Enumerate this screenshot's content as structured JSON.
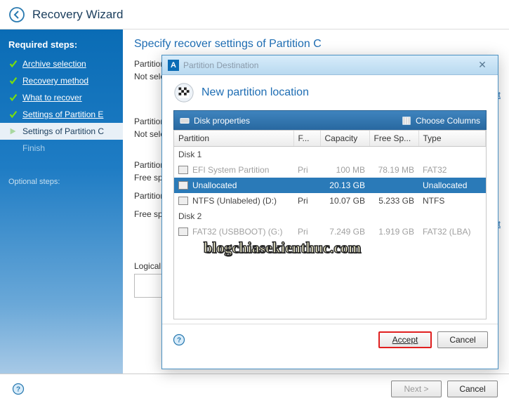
{
  "titlebar": {
    "title": "Recovery Wizard"
  },
  "sidebar": {
    "heading": "Required steps:",
    "steps": [
      {
        "label": "Archive selection",
        "done": true
      },
      {
        "label": "Recovery method",
        "done": true
      },
      {
        "label": "What to recover",
        "done": true
      },
      {
        "label": "Settings of Partition E",
        "done": true
      },
      {
        "label": "Settings of Partition C",
        "active": true
      },
      {
        "label": "Finish",
        "disabled": true
      }
    ],
    "optional_label": "Optional steps:"
  },
  "content": {
    "heading": "Specify recover settings of Partition C",
    "location_label": "Partition location (required)",
    "location_text": "Not selected",
    "type_label": "Partition type",
    "type_text": "Not selected",
    "size_label": "Partition size",
    "free_before_label": "Free space before:",
    "size_field_label": "Partition size:",
    "free_after_label": "Free space after:",
    "logical_label": "Logical drive letter",
    "default_link": "Default"
  },
  "footer": {
    "next": "Next >",
    "cancel": "Cancel"
  },
  "dialog": {
    "title": "Partition Destination",
    "heading": "New partition location",
    "toolbar": {
      "left": "Disk properties",
      "right": "Choose Columns"
    },
    "columns": {
      "partition": "Partition",
      "flags": "F...",
      "capacity": "Capacity",
      "freespace": "Free Sp...",
      "type": "Type"
    },
    "disks": [
      {
        "label": "Disk 1",
        "rows": [
          {
            "name": "EFI System Partition",
            "flags": "Pri",
            "capacity": "100 MB",
            "free": "78.19 MB",
            "type": "FAT32",
            "state": "disabled"
          },
          {
            "name": "Unallocated",
            "flags": "",
            "capacity": "20.13 GB",
            "free": "",
            "type": "Unallocated",
            "state": "selected"
          },
          {
            "name": "NTFS (Unlabeled) (D:)",
            "flags": "Pri",
            "capacity": "10.07 GB",
            "free": "5.233 GB",
            "type": "NTFS",
            "state": "normal"
          }
        ]
      },
      {
        "label": "Disk 2",
        "rows": [
          {
            "name": "FAT32 (USBBOOT) (G:)",
            "flags": "Pri",
            "capacity": "7.249 GB",
            "free": "1.919 GB",
            "type": "FAT32 (LBA)",
            "state": "disabled"
          }
        ]
      }
    ],
    "accept": "Accept",
    "cancel": "Cancel"
  },
  "watermark": "blogchiasekienthuc.com"
}
